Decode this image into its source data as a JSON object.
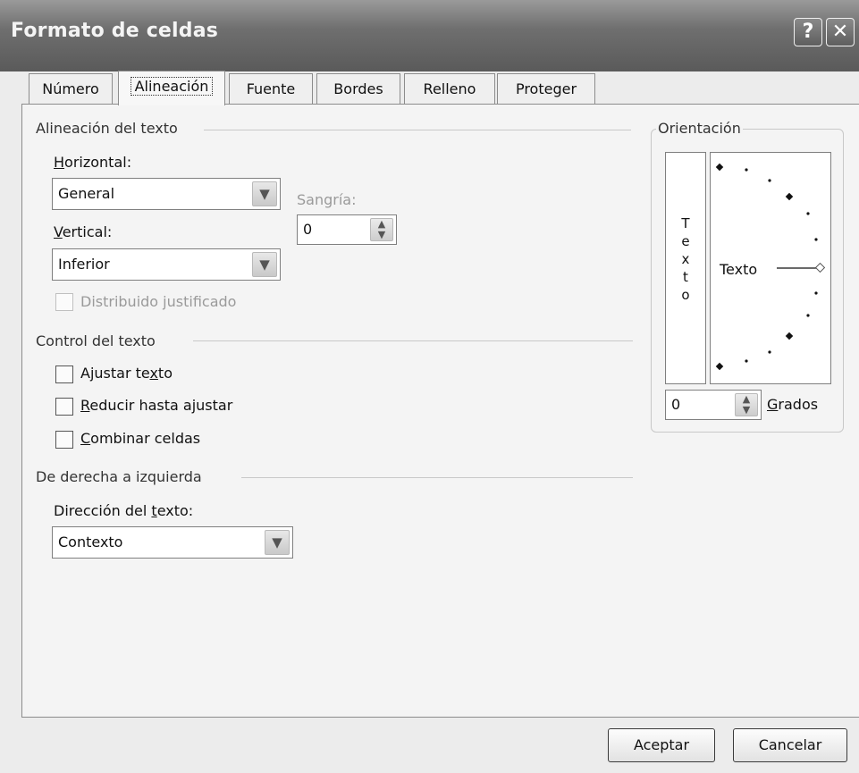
{
  "window": {
    "title": "Formato de celdas",
    "help_glyph": "?",
    "close_glyph": "✕"
  },
  "tabs": [
    {
      "label": "Número"
    },
    {
      "label": "Alineación"
    },
    {
      "label": "Fuente"
    },
    {
      "label": "Bordes"
    },
    {
      "label": "Relleno"
    },
    {
      "label": "Proteger"
    }
  ],
  "alignment": {
    "group_label": "Alineación del texto",
    "horizontal": {
      "label_u": "H",
      "label_rest": "orizontal:",
      "value": "General"
    },
    "indent": {
      "label": "Sangría:",
      "value": "0"
    },
    "vertical": {
      "label_u": "V",
      "label_rest": "ertical:",
      "value": "Inferior"
    },
    "distributed": {
      "label": "Distribuido justificado"
    }
  },
  "text_control": {
    "group_label": "Control del texto",
    "wrap": {
      "pre": "Ajustar te",
      "u": "x",
      "post": "to"
    },
    "shrink": {
      "pre": "",
      "u": "R",
      "post": "educir hasta ajustar"
    },
    "merge": {
      "pre": "",
      "u": "C",
      "post": "ombinar celdas"
    }
  },
  "rtl": {
    "group_label": "De derecha a izquierda",
    "direction": {
      "pre": "Dirección del ",
      "u": "t",
      "post": "exto:",
      "value": "Contexto"
    }
  },
  "orientation": {
    "group_label": "Orientación",
    "vertical_text": [
      "T",
      "e",
      "x",
      "t",
      "o"
    ],
    "dial_text": "Texto",
    "degrees_value": "0",
    "degrees_label_u": "G",
    "degrees_label_rest": "rados"
  },
  "buttons": {
    "ok": "Aceptar",
    "cancel": "Cancelar"
  }
}
